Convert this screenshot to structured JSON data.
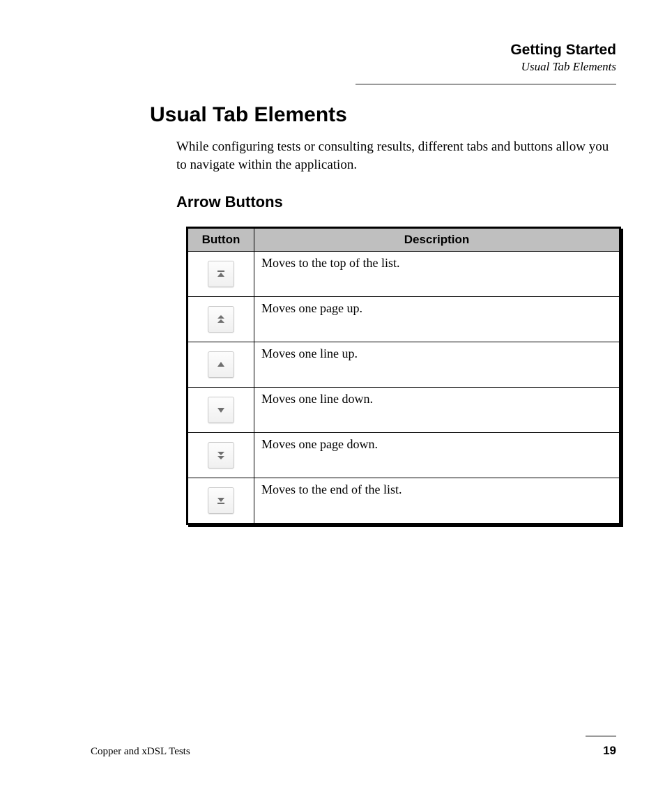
{
  "header": {
    "chapter": "Getting Started",
    "topic": "Usual Tab Elements"
  },
  "main": {
    "title": "Usual Tab Elements",
    "intro": "While configuring tests or consulting results, different tabs and buttons allow you to navigate within the application.",
    "subsection": "Arrow Buttons"
  },
  "table": {
    "headers": {
      "button": "Button",
      "description": "Description"
    },
    "rows": [
      {
        "icon": "go-top-icon",
        "description": "Moves to the top of the list."
      },
      {
        "icon": "page-up-icon",
        "description": "Moves one page up."
      },
      {
        "icon": "line-up-icon",
        "description": "Moves one line up."
      },
      {
        "icon": "line-down-icon",
        "description": "Moves one line down."
      },
      {
        "icon": "page-down-icon",
        "description": "Moves one page down."
      },
      {
        "icon": "go-end-icon",
        "description": "Moves to the end of the list."
      }
    ]
  },
  "footer": {
    "doc": "Copper and xDSL Tests",
    "page": "19"
  },
  "colors": {
    "arrow": "#6f6f6f"
  }
}
